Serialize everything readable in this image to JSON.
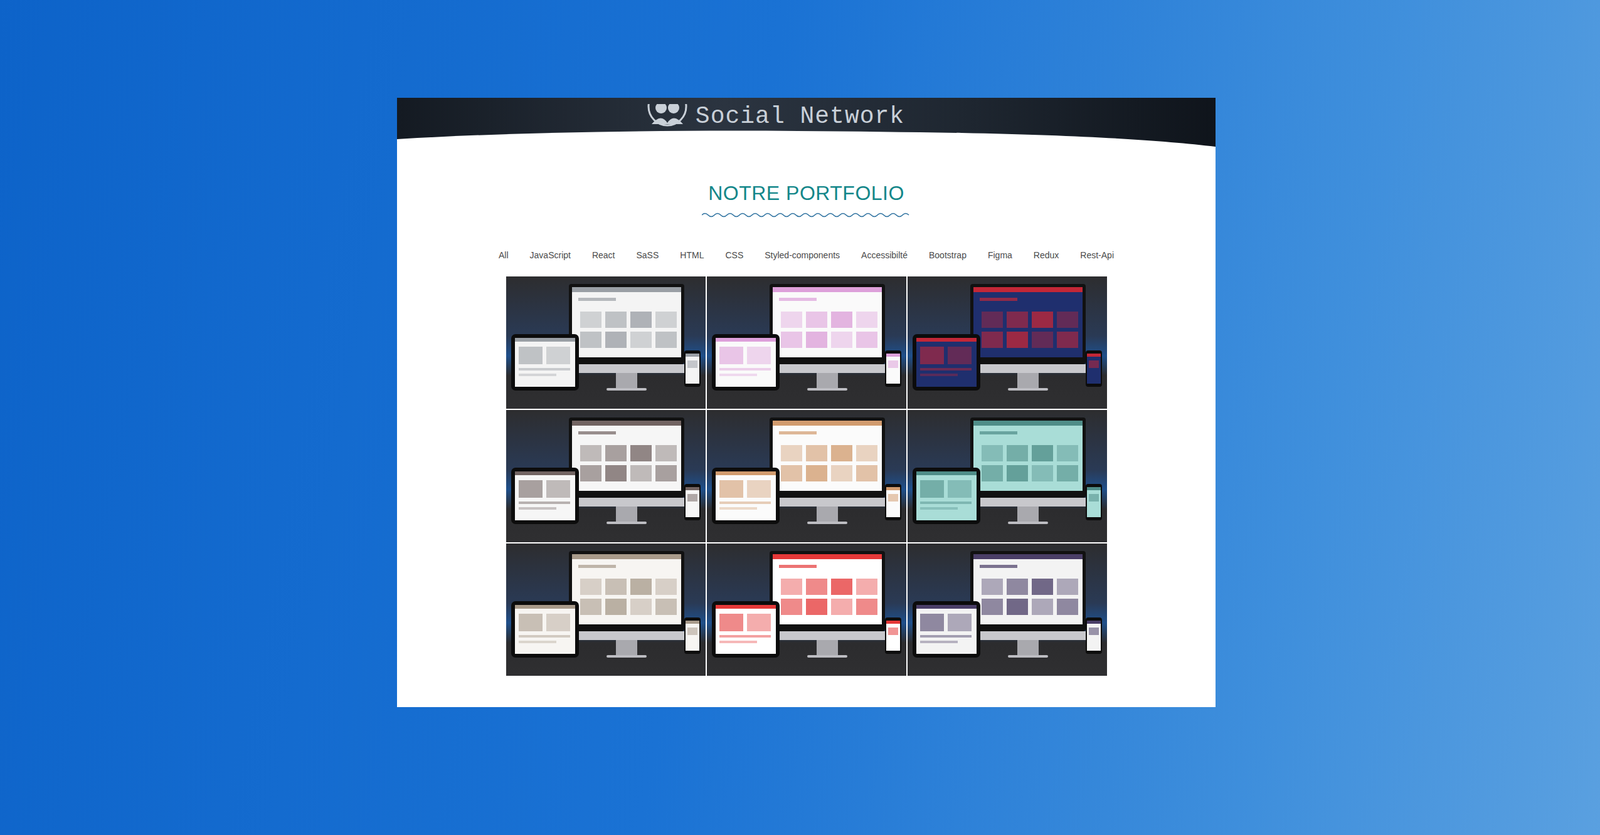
{
  "banner": {
    "title": "Social Network"
  },
  "section": {
    "title": "NOTRE PORTFOLIO"
  },
  "filters": [
    {
      "label": "All",
      "selected": false
    },
    {
      "label": "JavaScript",
      "selected": false
    },
    {
      "label": "React",
      "selected": false
    },
    {
      "label": "SaSS",
      "selected": false
    },
    {
      "label": "HTML",
      "selected": false
    },
    {
      "label": "CSS",
      "selected": false
    },
    {
      "label": "Styled-components",
      "selected": false
    },
    {
      "label": "Accessibilté",
      "selected": false
    },
    {
      "label": "Bootstrap",
      "selected": false
    },
    {
      "label": "Figma",
      "selected": false
    },
    {
      "label": "Redux",
      "selected": false
    },
    {
      "label": "Rest-Api",
      "selected": false
    }
  ],
  "projects": [
    {
      "color": "#f4f4f4",
      "accent": "#8a8f96"
    },
    {
      "color": "#fafafa",
      "accent": "#d78fd3"
    },
    {
      "color": "#1f2f6e",
      "accent": "#e0262e"
    },
    {
      "color": "#f6f6f6",
      "accent": "#5a4a48"
    },
    {
      "color": "#fbfbfb",
      "accent": "#c98a55"
    },
    {
      "color": "#a9ddd7",
      "accent": "#3f7f7a"
    },
    {
      "color": "#f7f5f2",
      "accent": "#9a8a78"
    },
    {
      "color": "#ffffff",
      "accent": "#e01515"
    },
    {
      "color": "#f3f3f3",
      "accent": "#2b1d4d"
    }
  ]
}
